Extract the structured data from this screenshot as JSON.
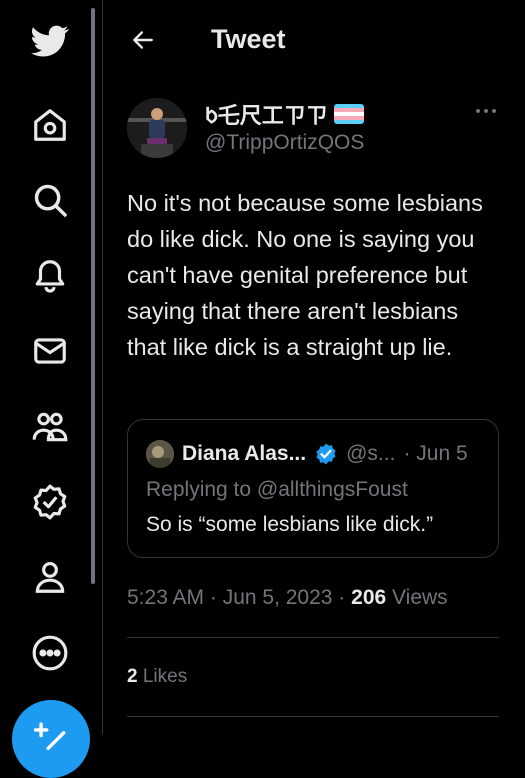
{
  "header": {
    "title": "Tweet"
  },
  "sidebar": {
    "icons": [
      "twitter-logo-icon",
      "home-icon",
      "search-icon",
      "notifications-icon",
      "messages-icon",
      "communities-icon",
      "verified-icon",
      "profile-icon",
      "more-icon"
    ]
  },
  "tweet": {
    "display_name": "ᱠ乇尺工ㄗㄗ",
    "handle": "@TrippOrtizQOS",
    "text": "No it's not because some lesbians do like dick. No one is saying you can't have genital preference but saying that there aren't lesbians that like dick is a straight up lie.",
    "time": "5:23 AM · Jun 5, 2023",
    "separator": " · ",
    "views_count": "206",
    "views_label": " Views",
    "likes_count": "2",
    "likes_label": " Likes"
  },
  "quote": {
    "name": "Diana Alas...",
    "handle": "@s...",
    "date": "· Jun 5",
    "replying": "Replying to @allthingsFoust",
    "text": "So is “some lesbians like dick.”"
  },
  "colors": {
    "accent": "#1d9bf0",
    "muted": "#71767b",
    "text": "#e7e9ea",
    "border": "#2f3336"
  }
}
